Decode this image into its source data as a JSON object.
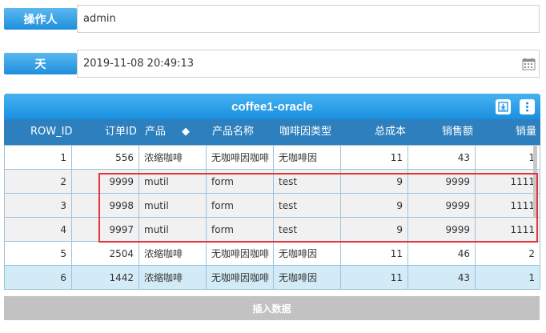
{
  "form": {
    "operator_label": "操作人",
    "operator_value": "admin",
    "day_label": "天",
    "day_value": "2019-11-08 20:49:13"
  },
  "panel": {
    "title": "coffee1-oracle"
  },
  "table": {
    "columns": [
      "ROW_ID",
      "订单ID",
      "产品",
      "产品名称",
      "咖啡因类型",
      "总成本",
      "销售额",
      "销量"
    ],
    "rows": [
      [
        "1",
        "556",
        "浓缩咖啡",
        "无咖啡因咖啡",
        "无咖啡因",
        "11",
        "43",
        "1"
      ],
      [
        "2",
        "9999",
        "mutil",
        "form",
        "test",
        "9",
        "9999",
        "1111"
      ],
      [
        "3",
        "9998",
        "mutil",
        "form",
        "test",
        "9",
        "9999",
        "1111"
      ],
      [
        "4",
        "9997",
        "mutil",
        "form",
        "test",
        "9",
        "9999",
        "1111"
      ],
      [
        "5",
        "2504",
        "浓缩咖啡",
        "无咖啡因咖啡",
        "无咖啡因",
        "11",
        "46",
        "2"
      ],
      [
        "6",
        "1442",
        "浓缩咖啡",
        "无咖啡因咖啡",
        "无咖啡因",
        "11",
        "43",
        "1"
      ]
    ]
  },
  "actions": {
    "insert_label": "插入数据"
  },
  "icons": {
    "calendar": "calendar-icon",
    "download": "download-icon",
    "more": "more-vertical-icon"
  },
  "colors": {
    "accent": "#1f8fdc",
    "table_header": "#2d7fbd",
    "highlight": "#e8323a",
    "selected_row": "#d3ebf6",
    "insert_button": "#c2c2c2"
  }
}
